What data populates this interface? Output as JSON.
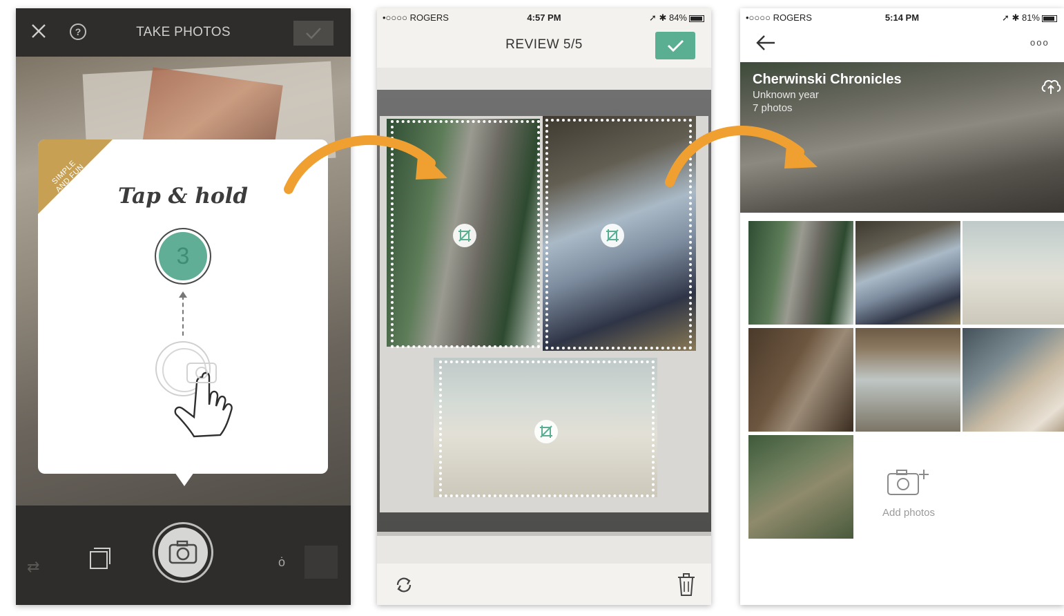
{
  "phone1": {
    "title": "TAKE PHOTOS",
    "help_label": "?",
    "ribbon": "SIMPLE\nAND FUN",
    "card_title": "Tap & hold",
    "step_number": "3",
    "timer_label": "ȯ",
    "flip_label": "⇄"
  },
  "phone2": {
    "status": {
      "carrier": "•○○○○ ROGERS",
      "time": "4:57 PM",
      "battery": "84%"
    },
    "title": "REVIEW 5/5"
  },
  "phone3": {
    "status": {
      "carrier": "•○○○○ ROGERS",
      "time": "5:14 PM",
      "battery": "81%"
    },
    "more_label": "ooo",
    "album": {
      "title": "Cherwinski Chronicles",
      "year": "Unknown year",
      "count": "7 photos"
    },
    "add_photos_label": "Add photos"
  },
  "colors": {
    "accent_green": "#5aaf92",
    "ribbon_gold": "#c7a054",
    "arrow_orange": "#f0a030"
  }
}
